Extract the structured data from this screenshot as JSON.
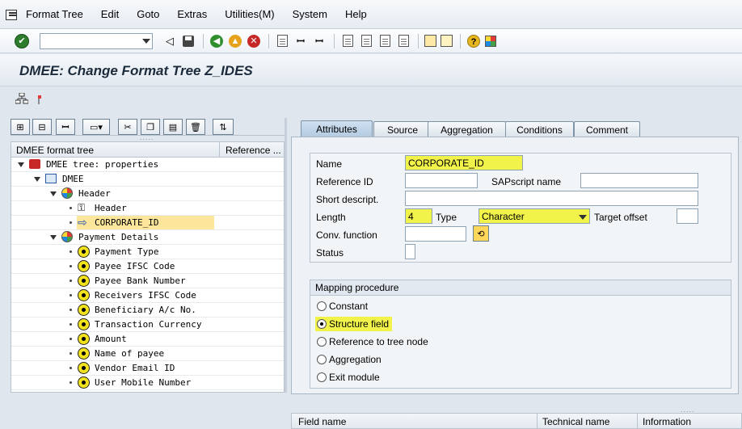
{
  "menu": {
    "items": [
      "Format Tree",
      "Edit",
      "Goto",
      "Extras",
      "Utilities(M)",
      "System",
      "Help"
    ]
  },
  "toolbar": {
    "command_field_value": "",
    "icons": [
      "enter-icon",
      "back-icon",
      "save-icon",
      "green-back-icon",
      "exit-icon",
      "cancel-icon",
      "print-icon",
      "find-icon",
      "find-next-icon",
      "first-page-icon",
      "previous-page-icon",
      "next-page-icon",
      "last-page-icon",
      "create-session-icon",
      "shortcut-icon",
      "help-icon",
      "layout-icon"
    ]
  },
  "title": "DMEE: Change Format Tree Z_IDES",
  "tree": {
    "toolbar_icons": [
      "expand-icon",
      "collapse-icon",
      "find-icon",
      "create-node-icon",
      "cut-icon",
      "copy-icon",
      "paste-icon",
      "delete-icon",
      "swap-icon"
    ],
    "columns": [
      "DMEE format tree",
      "Reference ..."
    ],
    "rows": [
      {
        "label": "DMEE tree: properties"
      },
      {
        "label": "DMEE"
      },
      {
        "label": "Header"
      },
      {
        "label": "Header"
      },
      {
        "label": "CORPORATE_ID"
      },
      {
        "label": "Payment Details"
      },
      {
        "label": "Payment Type"
      },
      {
        "label": "Payee IFSC Code"
      },
      {
        "label": "Payee Bank Number"
      },
      {
        "label": "Receivers IFSC Code"
      },
      {
        "label": "Beneficiary A/c No."
      },
      {
        "label": "Transaction Currency"
      },
      {
        "label": "Amount"
      },
      {
        "label": "Name of payee"
      },
      {
        "label": "Vendor Email ID"
      },
      {
        "label": "User Mobile Number"
      }
    ]
  },
  "tabs": [
    "Attributes",
    "Source",
    "Aggregation",
    "Conditions",
    "Comment"
  ],
  "attributes": {
    "name_label": "Name",
    "name_value": "CORPORATE_ID",
    "reference_id_label": "Reference ID",
    "reference_id_value": "",
    "sapscript_label": "SAPscript name",
    "sapscript_value": "",
    "short_descript_label": "Short descript.",
    "short_descript_value": "",
    "length_label": "Length",
    "length_value": "4",
    "type_label": "Type",
    "type_value": "Character",
    "target_offset_label": "Target offset",
    "target_offset_value": "",
    "conv_function_label": "Conv. function",
    "conv_function_value": "",
    "status_label": "Status",
    "status_value": ""
  },
  "mapping": {
    "title": "Mapping procedure",
    "options": [
      {
        "label": "Constant",
        "selected": false
      },
      {
        "label": "Structure field",
        "selected": true
      },
      {
        "label": "Reference to tree node",
        "selected": false
      },
      {
        "label": "Aggregation",
        "selected": false
      },
      {
        "label": "Exit module",
        "selected": false
      }
    ]
  },
  "bottom_grid": {
    "columns": [
      "Field name",
      "Technical name",
      "Information"
    ]
  },
  "colors": {
    "highlight": "#f2f34a",
    "selection": "#fbe69c",
    "title_text": "#1c2b3b",
    "active_tab": "#b4cbe2"
  }
}
